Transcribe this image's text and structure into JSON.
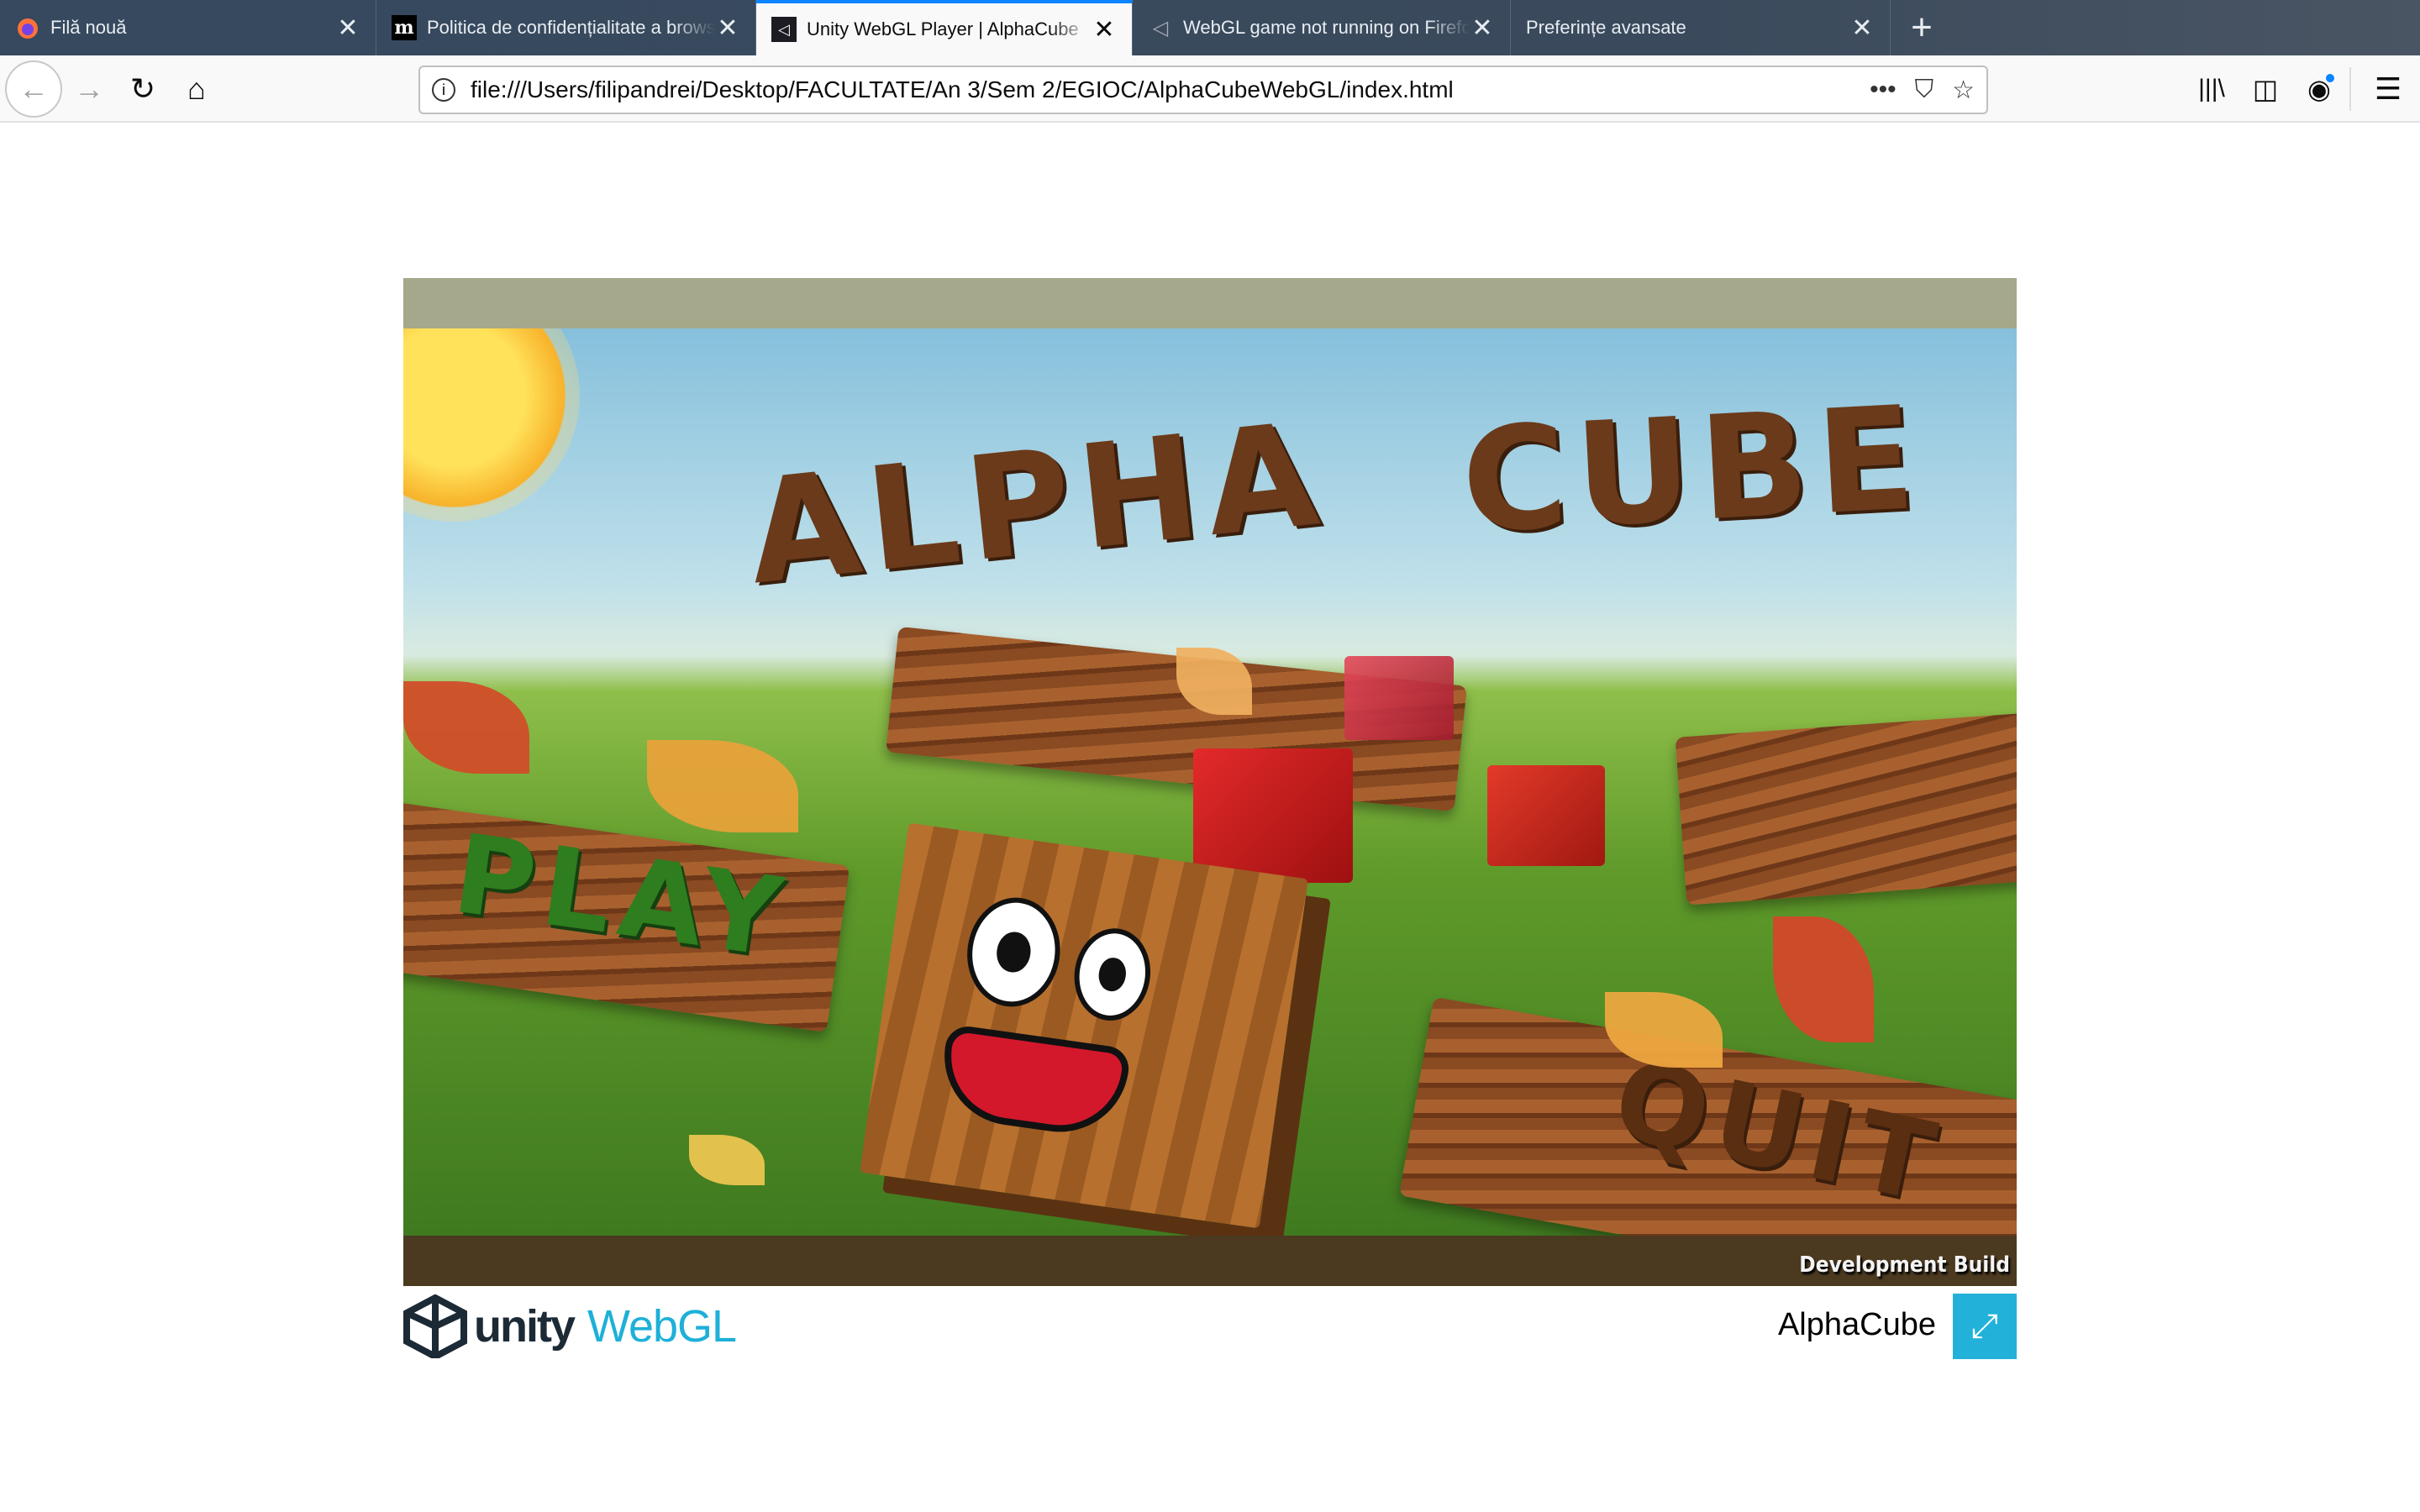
{
  "tabs": [
    {
      "label": "Filă nouă",
      "icon": "firefox-icon"
    },
    {
      "label": "Politica de confidențialitate a browserului",
      "icon": "medium-icon"
    },
    {
      "label": "Unity WebGL Player | AlphaCube",
      "icon": "unity-icon",
      "active": true
    },
    {
      "label": "WebGL game not running on Firefox",
      "icon": "unity-icon"
    },
    {
      "label": "Preferințe avansate",
      "icon": "none"
    }
  ],
  "toolbar": {
    "url": "file:///Users/filipandrei/Desktop/FACULTATE/An 3/Sem 2/EGIOC/AlphaCubeWebGL/index.html",
    "more": "•••"
  },
  "game": {
    "title_word1": "ALPHA",
    "title_word2": "CUBE",
    "play": "PLAY",
    "quit": "QUIT",
    "dev_build": "Development Build"
  },
  "footer": {
    "unity": "unity",
    "webgl": "WebGL",
    "title": "AlphaCube"
  },
  "colors": {
    "accent": "#0a84ff",
    "tabbar": "#38495c",
    "unity_blue": "#22b1d8",
    "dev_bar": "#4b3920"
  }
}
